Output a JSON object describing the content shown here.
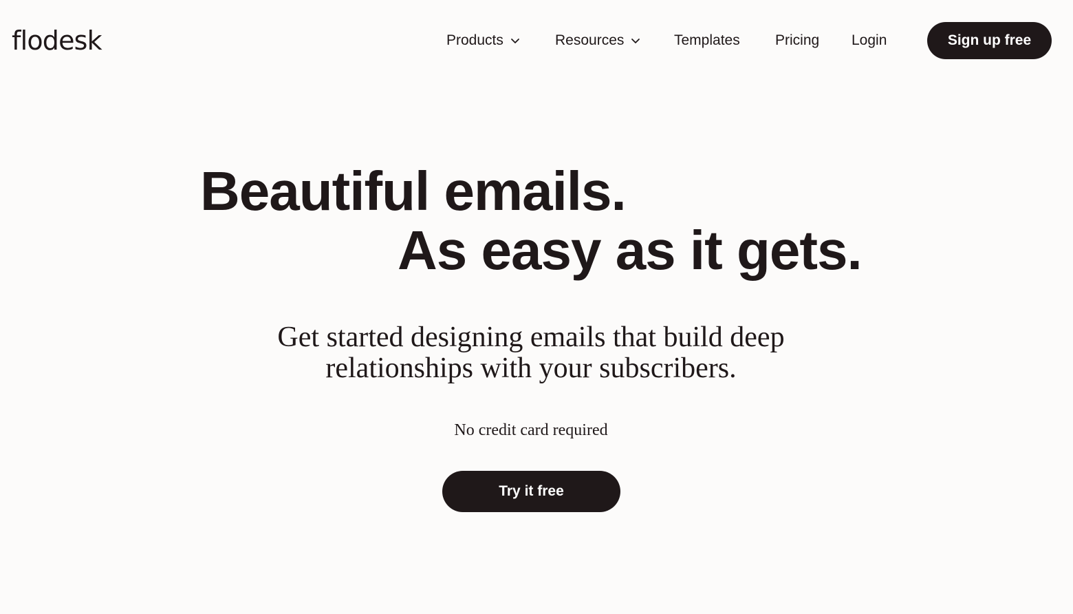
{
  "brand": {
    "name": "flodesk"
  },
  "nav": {
    "items": [
      {
        "label": "Products",
        "icon": "chevron-down-icon"
      },
      {
        "label": "Resources",
        "icon": "chevron-down-icon"
      },
      {
        "label": "Templates"
      },
      {
        "label": "Pricing"
      },
      {
        "label": "Login"
      }
    ],
    "cta_label": "Sign up free"
  },
  "hero": {
    "line1": "Beautiful emails.",
    "line2": "As easy as it gets.",
    "subhead_line1": "Get started designing emails that build deep",
    "subhead_line2": "relationships with your subscribers.",
    "note": "No credit card required",
    "cta_label": "Try it free"
  },
  "colors": {
    "background": "#fcfbfa",
    "text": "#1f1819",
    "button": "#1f1819",
    "button_text": "#ffffff"
  }
}
